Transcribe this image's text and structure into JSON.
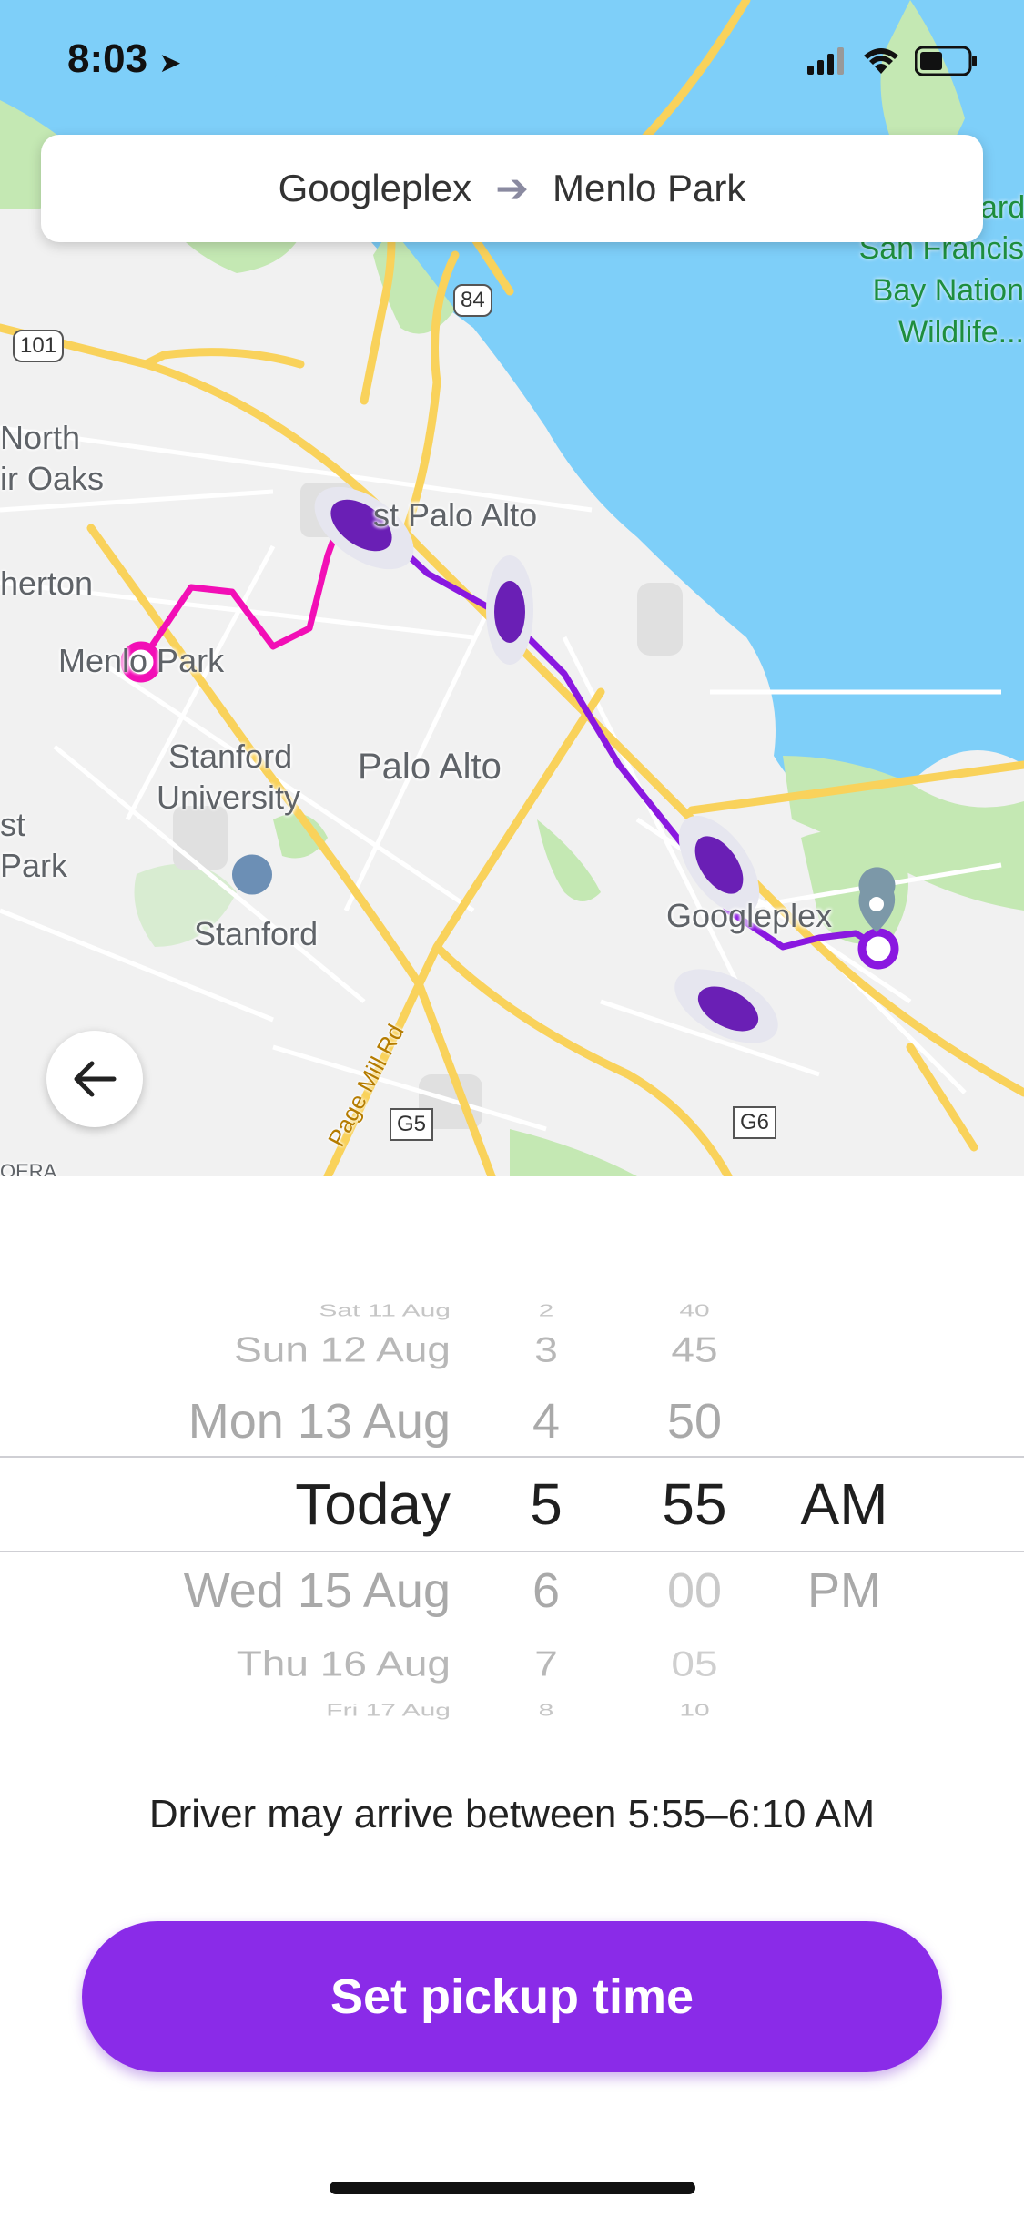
{
  "status_bar": {
    "time": "8:03",
    "location_icon": "location-arrow-icon",
    "icons": [
      "signal-icon",
      "wifi-icon",
      "battery-icon"
    ]
  },
  "route": {
    "origin": "Googleplex",
    "destination": "Menlo Park",
    "arrow_icon": "arrow-right-icon"
  },
  "map": {
    "labels": {
      "north_fair_oaks_1": "North",
      "north_fair_oaks_2": "ir Oaks",
      "atherton": "herton",
      "menlo_park": "Menlo Park",
      "east_palo_alto": "st Palo Alto",
      "stanford_university_1": "Stanford",
      "stanford_university_2": "University",
      "palo_alto": "Palo Alto",
      "stanford": "Stanford",
      "west_park_1": "st",
      "west_park_2": "Park",
      "googleplex": "Googleplex",
      "bay_refuge_1": "San Francis",
      "bay_refuge_2": "Bay Nation",
      "bay_refuge_3": "Wildlife...",
      "bay_refuge_0": "vard",
      "page_mill_rd": "Page Mill Rd",
      "bottom_left": "OERA"
    },
    "shields": {
      "us101": "101",
      "hwy84": "84",
      "g5": "G5",
      "g6": "G6"
    },
    "colors": {
      "water": "#7ecff9",
      "land": "#f1f1f1",
      "park": "#c4e8b3",
      "highway": "#f9d25b",
      "route_pink": "#f20fb6",
      "route_purple": "#8a18e0"
    }
  },
  "back_button": {
    "icon": "back-arrow-icon"
  },
  "picker": {
    "days": [
      "Sat 11 Aug",
      "Sun 12 Aug",
      "Mon 13 Aug",
      "Today",
      "Wed 15 Aug",
      "Thu 16 Aug",
      "Fri 17 Aug"
    ],
    "hours": [
      "2",
      "3",
      "4",
      "5",
      "6",
      "7",
      "8"
    ],
    "minutes": [
      "40",
      "45",
      "50",
      "55",
      "00",
      "05",
      "10"
    ],
    "ampm": [
      "",
      "",
      "",
      "AM",
      "PM",
      "",
      ""
    ],
    "selected": {
      "day": "Today",
      "hour": "5",
      "minute": "55",
      "ampm": "AM"
    }
  },
  "arrival_text": "Driver may arrive between 5:55–6:10 AM",
  "primary_button": {
    "label": "Set pickup time",
    "color": "#8a2be8"
  }
}
